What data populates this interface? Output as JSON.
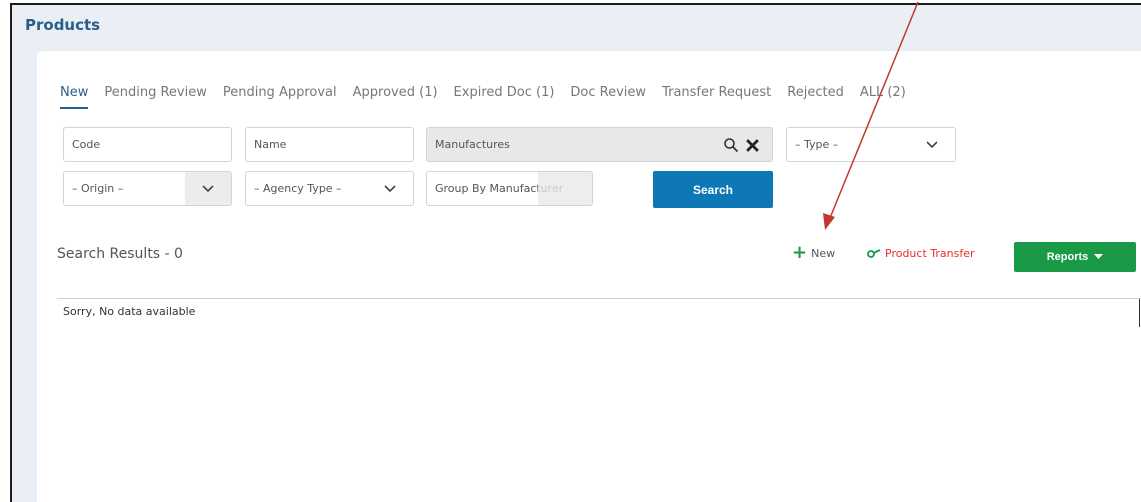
{
  "page": {
    "title": "Products"
  },
  "tabs": [
    {
      "label": "New",
      "active": true
    },
    {
      "label": "Pending Review"
    },
    {
      "label": "Pending Approval"
    },
    {
      "label": "Approved (1)"
    },
    {
      "label": "Expired Doc (1)"
    },
    {
      "label": "Doc Review"
    },
    {
      "label": "Transfer Request"
    },
    {
      "label": "Rejected"
    },
    {
      "label": "ALL (2)"
    }
  ],
  "filters": {
    "code_placeholder": "Code",
    "name_placeholder": "Name",
    "manufactures_placeholder": "Manufactures",
    "type_label": "– Type –",
    "origin_label": "– Origin –",
    "agency_type_label": "– Agency Type –",
    "group_by_label": "Group By Manufacturer",
    "search_label": "Search"
  },
  "results": {
    "label": "Search Results - 0",
    "new_label": "New",
    "transfer_label": "Product Transfer",
    "reports_label": "Reports",
    "empty_message": "Sorry, No data available"
  },
  "colors": {
    "accent_blue": "#0e78b7",
    "title_blue": "#2b5d8b",
    "green": "#1a9946",
    "red": "#e8302c",
    "annotation_arrow": "#c0392b"
  },
  "icons": {
    "search": "magnifier-icon",
    "clear": "close-icon",
    "dropdown": "chevron-down-icon",
    "new": "plus-icon",
    "transfer": "transfer-icon",
    "reports_caret": "caret-down-icon"
  }
}
